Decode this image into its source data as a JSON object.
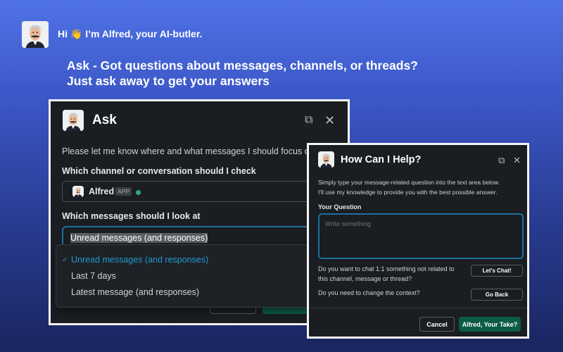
{
  "intro": {
    "greeting": "Hi 👋 I’m Alfred, your AI-butler.",
    "headline_1": "Ask - Got questions about messages, channels, or threads?",
    "headline_2": "Just ask away to get your answers"
  },
  "ask": {
    "title": "Ask",
    "description": "Please let me know where and what messages I should focus on",
    "channel_label": "Which channel or conversation should I check",
    "channel_value": "Alfred",
    "channel_badge": "APP",
    "messages_label": "Which messages should I look at",
    "messages_value": "Unread messages (and responses)",
    "options": [
      "Unread messages (and responses)",
      "Last 7 days",
      "Latest message (and responses)"
    ],
    "selected_mark": "✓"
  },
  "help": {
    "title": "How Can I Help?",
    "description_1": "Simply type your message-related question into the text area below.",
    "description_2": "I'll use my knowledge to provide you with the best possible answer.",
    "question_label": "Your Question",
    "question_placeholder": "Write something",
    "chat_prompt_1": "Do you want to chat 1:1 something not related to",
    "chat_prompt_2": "this channel, message or thread?",
    "chat_button": "Let's Chat!",
    "context_prompt": "Do you need to change the context?",
    "back_button": "Go Back",
    "cancel_button": "Cancel",
    "submit_button": "Alfred, Your Take?"
  },
  "colors": {
    "accent": "#1d9bd1",
    "green": "#007a5a",
    "online": "#2bac76"
  }
}
